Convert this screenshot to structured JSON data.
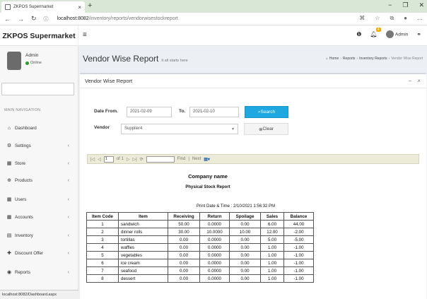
{
  "browser": {
    "tab_title": "ZKPOS Supermarket",
    "tab_close": "×",
    "new_tab": "+",
    "url_host": "localhost:8082",
    "url_path": "/inventory/reports/vendorwisestockreport",
    "status_url": "localhost:8082/Dashboard.aspx"
  },
  "app": {
    "brand": "ZKPOS Supermarket",
    "header_user": "Admin",
    "notif_count": "4"
  },
  "sidebar": {
    "user_name": "Admin",
    "user_status": "Online",
    "nav_header": "MAIN NAVIGATION",
    "items": [
      {
        "label": "Dashboard",
        "icon": "dashboard-icon",
        "chevron": false
      },
      {
        "label": "Settings",
        "icon": "gear-icon",
        "chevron": true
      },
      {
        "label": "Store",
        "icon": "store-icon",
        "chevron": true
      },
      {
        "label": "Products",
        "icon": "products-icon",
        "chevron": true
      },
      {
        "label": "Users",
        "icon": "users-icon",
        "chevron": true
      },
      {
        "label": "Accounts",
        "icon": "accounts-icon",
        "chevron": true
      },
      {
        "label": "Inventory",
        "icon": "inventory-icon",
        "chevron": true
      },
      {
        "label": "Discount Offer",
        "icon": "plus-icon",
        "chevron": true
      },
      {
        "label": "Reports",
        "icon": "reports-icon",
        "chevron": true
      }
    ]
  },
  "page": {
    "title": "Vendor Wise Report",
    "subtitle": "it all starts here",
    "breadcrumb": [
      "Home",
      "Reports",
      "Inventory Reports",
      "Vendor Wise Report"
    ]
  },
  "box": {
    "title": "Vendor Wise Report",
    "collapse": "−",
    "close": "×"
  },
  "form": {
    "date_from_label": "Date From.",
    "date_from_value": "2021-02-09",
    "to_label": "To.",
    "to_value": "2021-02-10",
    "search_button": "Search",
    "vendor_label": "Vendor",
    "vendor_value": "Supplier4",
    "clear_button": "Clear"
  },
  "reportviewer": {
    "page_value": "1",
    "page_of": "of 1",
    "find": "Find",
    "next": "Next"
  },
  "report": {
    "company": "Company name",
    "title": "Physical Stock Report",
    "print_date": "Print Date & Time : 2/10/2021 1:56:32 PM",
    "columns": [
      "Item Code",
      "Item",
      "Receiving",
      "Return",
      "Spoilage",
      "Sales",
      "Balance"
    ],
    "rows": [
      [
        "1",
        "sandwich",
        "50.00",
        "0.0000",
        "0.00",
        "6.00",
        "44.00"
      ],
      [
        "2",
        "dinner rolls",
        "30.00",
        "10.0000",
        "10.00",
        "12.00",
        "-2.00"
      ],
      [
        "3",
        "tortillas",
        "0.00",
        "0.0000",
        "0.00",
        "5.00",
        "-5.00"
      ],
      [
        "4",
        "waffles",
        "0.00",
        "0.0000",
        "0.00",
        "1.00",
        "-1.00"
      ],
      [
        "5",
        "vegetables",
        "0.00",
        "0.0000",
        "0.00",
        "1.00",
        "-1.00"
      ],
      [
        "6",
        "ice cream",
        "0.00",
        "0.0000",
        "0.00",
        "1.00",
        "-1.00"
      ],
      [
        "7",
        "seafood",
        "0.00",
        "0.0000",
        "0.00",
        "1.00",
        "-1.00"
      ],
      [
        "8",
        "dessert",
        "0.00",
        "0.0000",
        "0.00",
        "1.00",
        "-1.00"
      ]
    ]
  }
}
